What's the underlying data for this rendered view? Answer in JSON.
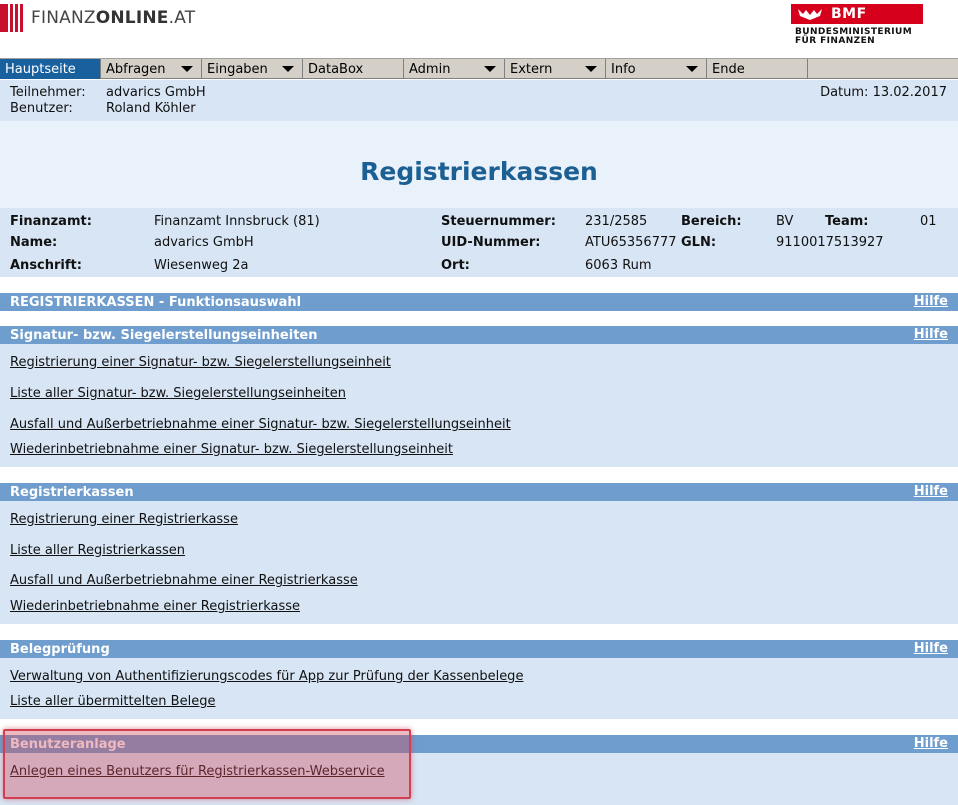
{
  "header": {
    "logo_left_plain": "FINANZ",
    "logo_left_bold": "ONLINE",
    "logo_left_suffix": ".AT",
    "bmf_short": "BMF",
    "bmf_line1": "BUNDESMINISTERIUM",
    "bmf_line2": "FÜR FINANZEN",
    "brand_red": "#d6001c"
  },
  "nav": {
    "items": [
      {
        "label": "Hauptseite",
        "dropdown": false,
        "active": true
      },
      {
        "label": "Abfragen",
        "dropdown": true,
        "active": false
      },
      {
        "label": "Eingaben",
        "dropdown": true,
        "active": false
      },
      {
        "label": "DataBox",
        "dropdown": false,
        "active": false
      },
      {
        "label": "Admin",
        "dropdown": true,
        "active": false
      },
      {
        "label": "Extern",
        "dropdown": true,
        "active": false
      },
      {
        "label": "Info",
        "dropdown": true,
        "active": false
      },
      {
        "label": "Ende",
        "dropdown": false,
        "active": false
      }
    ],
    "active_color": "#19609e"
  },
  "userinfo": {
    "participant_label": "Teilnehmer:",
    "participant_value": "advarics GmbH",
    "user_label": "Benutzer:",
    "user_value": "Roland Köhler",
    "date": "Datum: 13.02.2017"
  },
  "page_title": "Registrierkassen",
  "details": {
    "finanzamt_label": "Finanzamt:",
    "finanzamt_value": "Finanzamt Innsbruck (81)",
    "name_label": "Name:",
    "name_value": "advarics GmbH",
    "anschrift_label": "Anschrift:",
    "anschrift_value": "Wiesenweg 2a",
    "steuernummer_label": "Steuernummer:",
    "steuernummer_value": "231/2585",
    "uid_label": "UID-Nummer:",
    "uid_value": "ATU65356777",
    "ort_label": "Ort:",
    "ort_value": "6063 Rum",
    "bereich_label": "Bereich:",
    "bereich_value": "BV",
    "gln_label": "GLN:",
    "gln_value": "9110017513927",
    "team_label": "Team:",
    "team_value": "01"
  },
  "sections": {
    "funktionsauswahl": {
      "title": "REGISTRIERKASSEN - Funktionsauswahl",
      "help": "Hilfe"
    },
    "signatur": {
      "title": "Signatur- bzw. Siegelerstellungseinheiten",
      "help": "Hilfe",
      "links": [
        "Registrierung einer Signatur- bzw. Siegelerstellungseinheit",
        "Liste aller Signatur- bzw. Siegelerstellungseinheiten",
        "Ausfall und Außerbetriebnahme einer Signatur- bzw. Siegelerstellungseinheit",
        "Wiederinbetriebnahme einer Signatur- bzw. Siegelerstellungseinheit"
      ]
    },
    "registrierkassen": {
      "title": "Registrierkassen",
      "help": "Hilfe",
      "links": [
        "Registrierung einer Registrierkasse",
        "Liste aller Registrierkassen",
        "Ausfall und Außerbetriebnahme einer Registrierkasse",
        "Wiederinbetriebnahme einer Registrierkasse"
      ]
    },
    "belegpruefung": {
      "title": "Belegprüfung",
      "help": "Hilfe",
      "links": [
        "Verwaltung von Authentifizierungscodes für App zur Prüfung der Kassenbelege",
        "Liste aller übermittelten Belege"
      ]
    },
    "benutzeranlage": {
      "title": "Benutzeranlage",
      "help": "Hilfe",
      "links": [
        "Anlegen eines Benutzers für Registrierkassen-Webservice"
      ]
    }
  },
  "colors": {
    "section_header": "#6f9dcd",
    "section_body": "#d7e5f5",
    "title_text": "#1b5f93",
    "highlight": "#d04050"
  }
}
